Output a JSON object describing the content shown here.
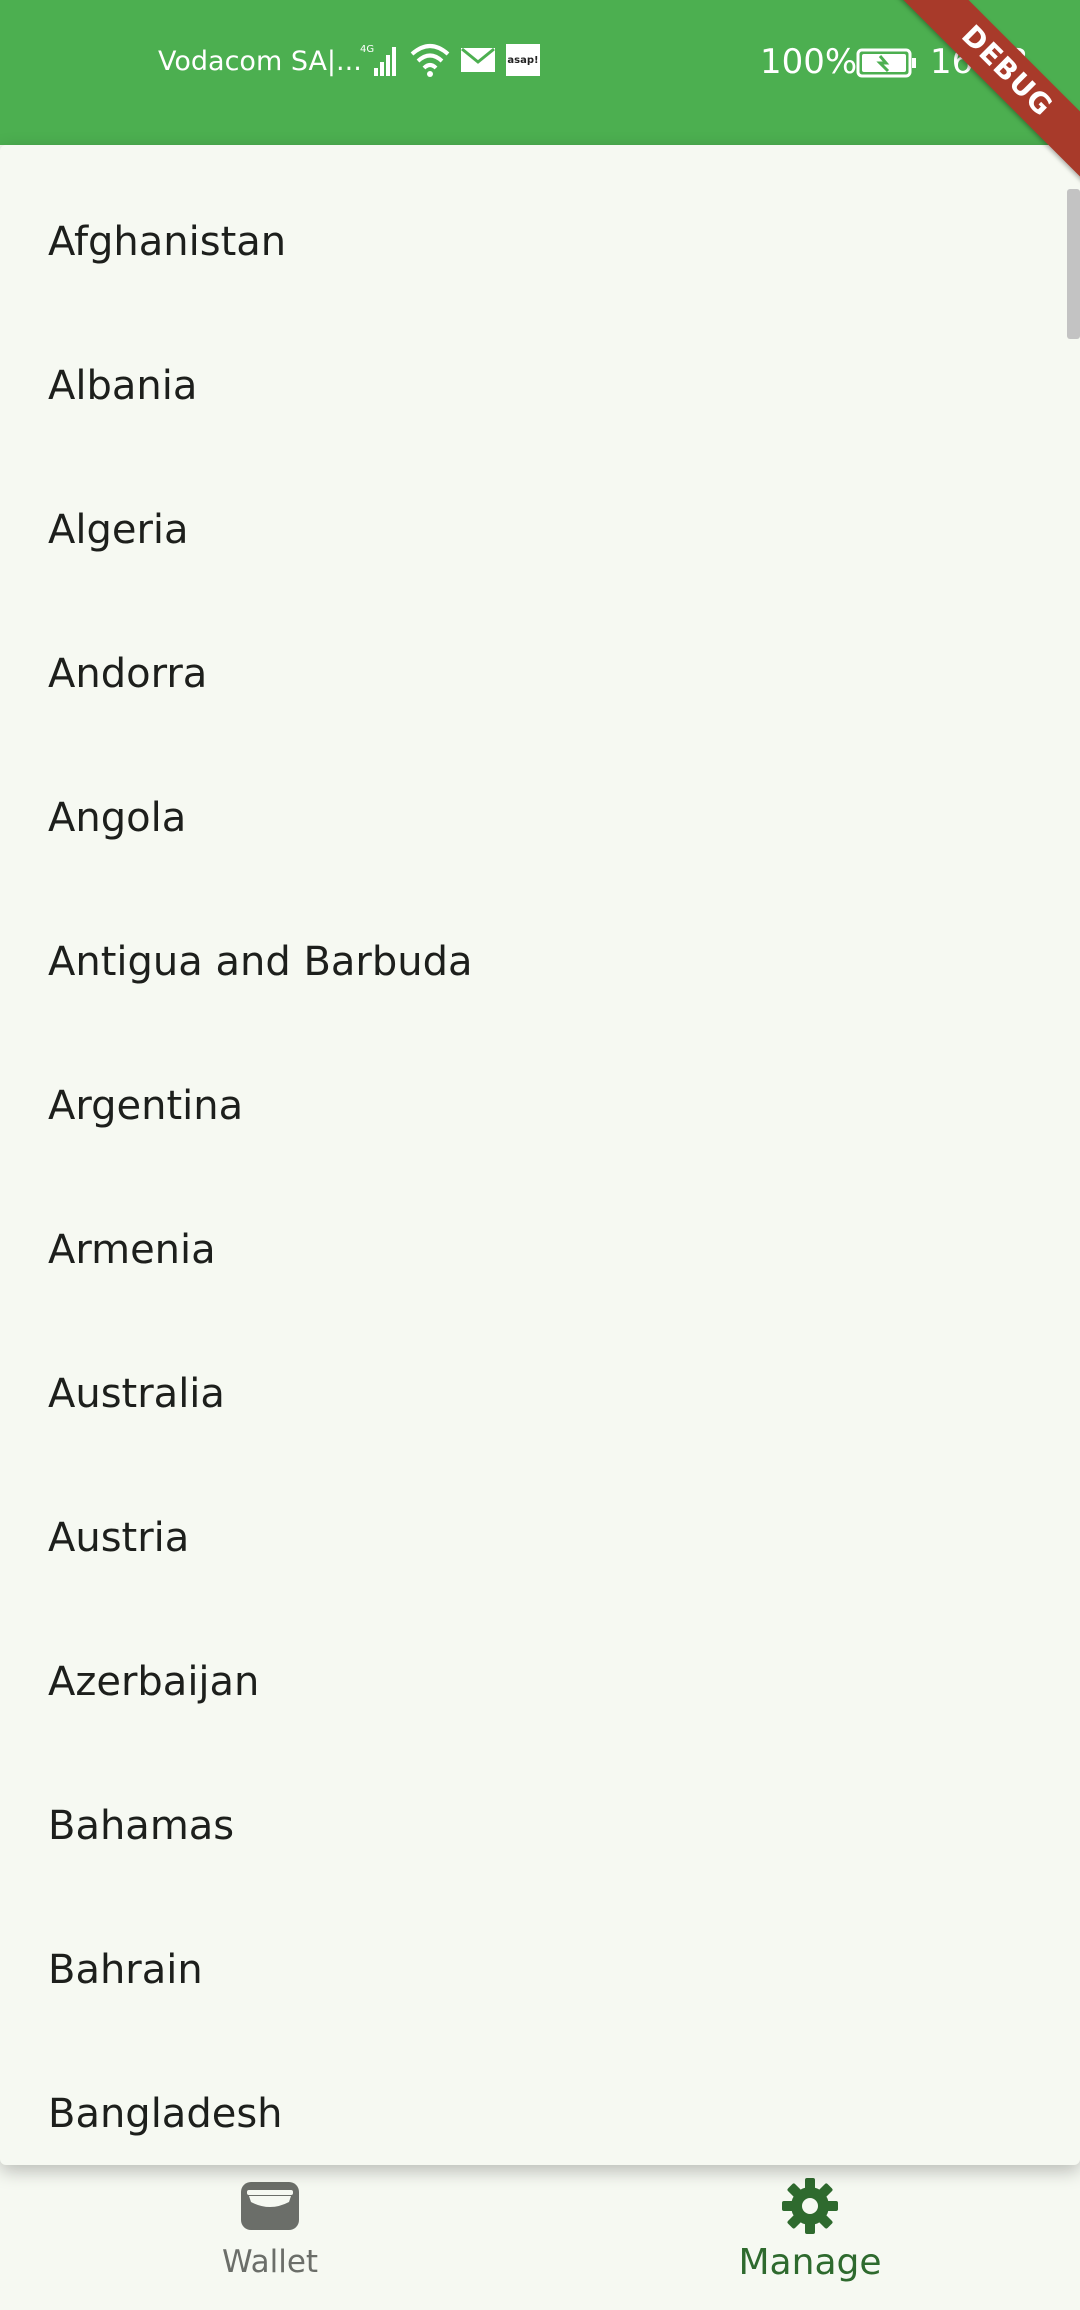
{
  "status_bar": {
    "carrier": "Vodacom SA|...",
    "network": "4G",
    "battery_percent": "100%",
    "time": "16:58",
    "icons": [
      "signal-icon",
      "wifi-icon",
      "mail-icon",
      "asap-app-icon",
      "battery-icon"
    ],
    "asap_label": "asap!",
    "debug_label": "DEBUG",
    "bar_color": "#4caf50"
  },
  "countries": {
    "items": [
      "Afghanistan",
      "Albania",
      "Algeria",
      "Andorra",
      "Angola",
      "Antigua and Barbuda",
      "Argentina",
      "Armenia",
      "Australia",
      "Austria",
      "Azerbaijan",
      "Bahamas",
      "Bahrain",
      "Bangladesh"
    ]
  },
  "bottom_nav": {
    "wallet_label": "Wallet",
    "manage_label": "Manage",
    "active": "Manage",
    "active_color": "#2e6a2e",
    "inactive_color": "#6b6e69"
  }
}
